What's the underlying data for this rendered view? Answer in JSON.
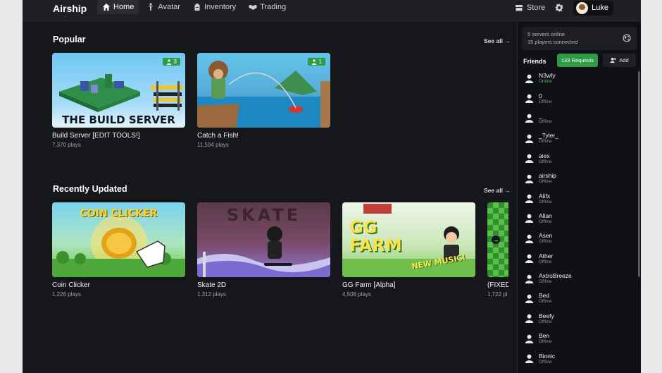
{
  "app": {
    "brand": "Airship"
  },
  "nav": [
    {
      "label": "Home",
      "icon": "home-icon",
      "active": true
    },
    {
      "label": "Avatar",
      "icon": "person-icon",
      "active": false
    },
    {
      "label": "Inventory",
      "icon": "backpack-icon",
      "active": false
    },
    {
      "label": "Trading",
      "icon": "handshake-icon",
      "active": false
    }
  ],
  "header": {
    "store_label": "Store",
    "username": "Luke"
  },
  "sections": {
    "popular": {
      "title": "Popular",
      "see_all": "See all →",
      "cards": [
        {
          "title": "Build Server [EDIT TOOLS!]",
          "plays": "7,370 plays",
          "badge": "3",
          "thumb_text": "THE BUILD SERVER"
        },
        {
          "title": "Catch a Fish!",
          "plays": "11,594 plays",
          "badge": "1"
        }
      ]
    },
    "recent": {
      "title": "Recently Updated",
      "see_all": "See all →",
      "cards": [
        {
          "title": "Coin Clicker",
          "plays": "1,226 plays",
          "thumb_text": "COIN CLICKER"
        },
        {
          "title": "Skate 2D",
          "plays": "1,312 plays",
          "thumb_text": "SKATE"
        },
        {
          "title": "GG Farm [Alpha]",
          "plays": "4,508 plays",
          "thumb_text": "GG FARM",
          "thumb_sub": "NEW MUSIC!"
        },
        {
          "title": "(FIXED",
          "plays": "1,722 pl"
        }
      ]
    }
  },
  "sidebar": {
    "servers_online": "5 servers online",
    "players_connected": "15 players connected",
    "friends_label": "Friends",
    "requests_label": "133 Requests",
    "add_label": "Add",
    "friends": [
      {
        "name": "N3wfy",
        "status": "Online"
      },
      {
        "name": "0",
        "status": "Offline"
      },
      {
        "name": "_",
        "status": "Offline"
      },
      {
        "name": "_Tyler_",
        "status": "Offline"
      },
      {
        "name": "aiex",
        "status": "Offline"
      },
      {
        "name": "airship",
        "status": "Offline"
      },
      {
        "name": "Alifx",
        "status": "Offline"
      },
      {
        "name": "Allan",
        "status": "Offline"
      },
      {
        "name": "Asen",
        "status": "Offline"
      },
      {
        "name": "Ather",
        "status": "Offline"
      },
      {
        "name": "AxtroBreeze",
        "status": "Offline"
      },
      {
        "name": "Bed",
        "status": "Offline"
      },
      {
        "name": "Beefy",
        "status": "Offline"
      },
      {
        "name": "Ben",
        "status": "Offline"
      },
      {
        "name": "Bionic",
        "status": "Offline"
      }
    ]
  },
  "colors": {
    "accent_green": "#2e9b47",
    "background": "#16171b",
    "online": "#39c25a"
  }
}
